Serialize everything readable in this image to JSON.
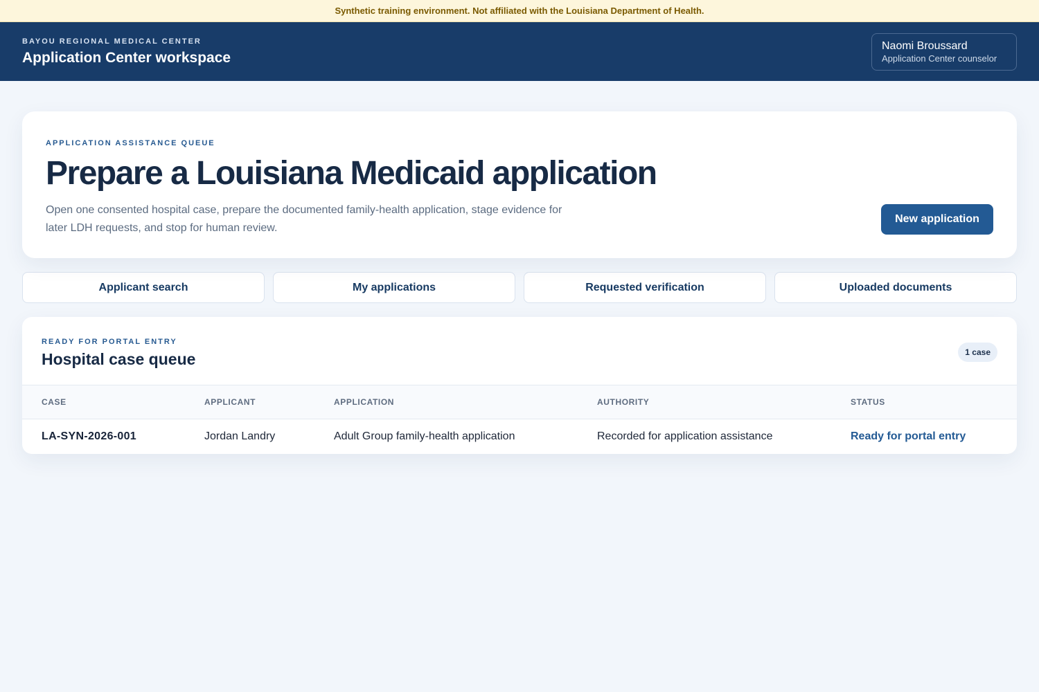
{
  "notice": {
    "text": "Synthetic training environment. Not affiliated with the Louisiana Department of Health."
  },
  "header": {
    "org": "BAYOU REGIONAL MEDICAL CENTER",
    "title": "Application Center workspace",
    "user": {
      "name": "Naomi Broussard",
      "role": "Application Center counselor"
    }
  },
  "hero": {
    "eyebrow": "APPLICATION ASSISTANCE QUEUE",
    "title": "Prepare a Louisiana Medicaid application",
    "description": "Open one consented hospital case, prepare the documented family-health application, stage evidence for later LDH requests, and stop for human review.",
    "new_button_label": "New application"
  },
  "tabs": [
    {
      "label": "Applicant search"
    },
    {
      "label": "My applications"
    },
    {
      "label": "Requested verification"
    },
    {
      "label": "Uploaded documents"
    }
  ],
  "queue": {
    "eyebrow": "READY FOR PORTAL ENTRY",
    "title": "Hospital case queue",
    "count_badge": "1 case",
    "columns": [
      "CASE",
      "APPLICANT",
      "APPLICATION",
      "AUTHORITY",
      "STATUS"
    ],
    "rows": [
      {
        "case": "LA-SYN-2026-001",
        "applicant": "Jordan Landry",
        "application": "Adult Group family-health application",
        "authority": "Recorded for application assistance",
        "status": "Ready for portal entry"
      }
    ]
  },
  "colors": {
    "header_bg": "#183c69",
    "accent": "#235a94",
    "notice_bg": "#fdf6dc",
    "notice_text": "#7a5a00",
    "page_bg": "#f2f6fb"
  }
}
